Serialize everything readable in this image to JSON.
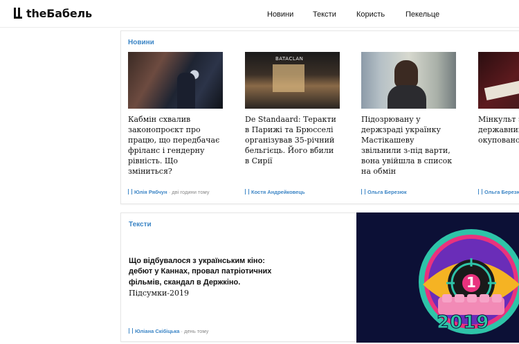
{
  "header": {
    "logo_text": "theБабель",
    "nav": [
      "Новини",
      "Тексти",
      "Користь",
      "Пекельце"
    ]
  },
  "news_section": {
    "label": "Новини",
    "items": [
      {
        "title": "Кабмін схвалив законопроєкт про працю, що передбачає фріланс і гендерну рівність. Що зміниться?",
        "author": "Юлія Рябчун",
        "time": " · дві години тому"
      },
      {
        "title": "De Standaard: Теракти в Парижі та Брюсселі організував 35-річний бельгієць. Його вбили в Сирії",
        "author": "Костя Андрейковець",
        "time": ""
      },
      {
        "title": "Підозрювану у держзраді українку Мастікашеву звільнили з-під варти, вона увійшла в список на обмін",
        "author": "Ольга Березюк",
        "time": ""
      },
      {
        "title": "Мінкульт за державний для тимча окуповано",
        "author": "Ольга Березюк",
        "time": ""
      }
    ]
  },
  "texts_section": {
    "label": "Тексти",
    "headline_bold": "Що відбувалося з українським кіно: дебют у Каннах, провал патріотичних фільмів, скандал в Держкіно.",
    "headline_rest": " Підсумки-2019",
    "author": "Юліана Скібіцька",
    "time": " · день тому",
    "poster_label": "2019",
    "poster_number": "1"
  },
  "colors": {
    "accent": "#3d86c6",
    "poster_bg": "#0c1036",
    "poster_ring": "#2ec4a8",
    "poster_eye": "#f5b323",
    "poster_seats": "#f28ab6"
  }
}
